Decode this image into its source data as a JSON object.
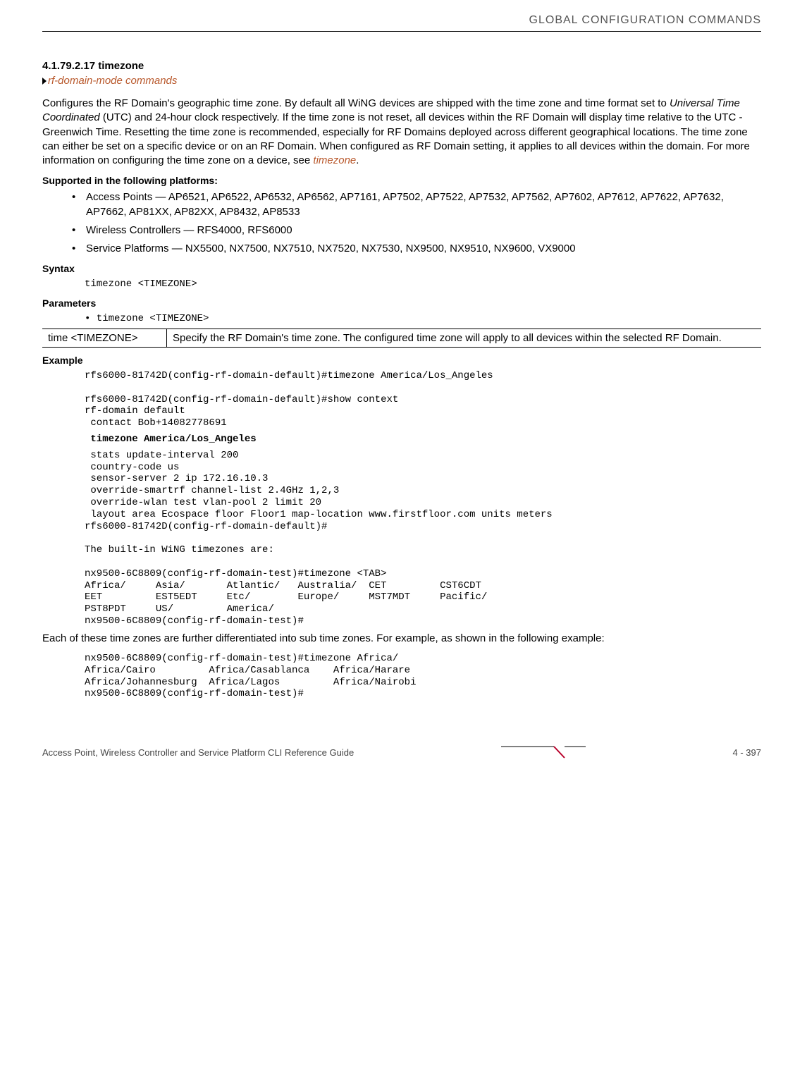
{
  "header": {
    "title": "GLOBAL CONFIGURATION COMMANDS"
  },
  "section": {
    "number": "4.1.79.2.17  timezone",
    "arrow_link": "rf-domain-mode commands",
    "para1_part1": "Configures the RF Domain's geographic time zone. By default all WiNG devices are shipped with the time zone and time format set to ",
    "para1_italic": "Universal Time Coordinated",
    "para1_part2": " (UTC) and 24-hour clock respectively. If the time zone is not reset, all devices within the RF Domain will display time relative to the UTC - Greenwich Time. Resetting the time zone is recommended, especially for RF Domains deployed across different geographical locations. The time zone can either be set on a specific device or on an RF Domain. When configured as RF Domain setting, it applies to all devices within the domain. For more information on configuring the time zone on a device, see ",
    "para1_link": "timezone",
    "para1_part3": "."
  },
  "platforms": {
    "heading": "Supported in the following platforms:",
    "items": [
      "Access Points — AP6521, AP6522, AP6532, AP6562, AP7161, AP7502, AP7522, AP7532, AP7562, AP7602, AP7612, AP7622, AP7632, AP7662, AP81XX, AP82XX, AP8432, AP8533",
      "Wireless Controllers — RFS4000, RFS6000",
      "Service Platforms — NX5500, NX7500, NX7510, NX7520, NX7530, NX9500, NX9510, NX9600, VX9000"
    ]
  },
  "syntax": {
    "heading": "Syntax",
    "code": "timezone <TIMEZONE>"
  },
  "parameters": {
    "heading": "Parameters",
    "param_line": "• timezone <TIMEZONE>",
    "table": {
      "cell1": "time <TIMEZONE>",
      "cell2": "Specify the RF Domain's time zone. The configured time zone will apply to all devices within the selected RF Domain."
    }
  },
  "example": {
    "heading": "Example",
    "code1": "rfs6000-81742D(config-rf-domain-default)#timezone America/Los_Angeles\n\nrfs6000-81742D(config-rf-domain-default)#show context\nrf-domain default\n contact Bob+14082778691",
    "code_bold": " timezone America/Los_Angeles",
    "code2": " stats update-interval 200\n country-code us\n sensor-server 2 ip 172.16.10.3\n override-smartrf channel-list 2.4GHz 1,2,3\n override-wlan test vlan-pool 2 limit 20\n layout area Ecospace floor Floor1 map-location www.firstfloor.com units meters\nrfs6000-81742D(config-rf-domain-default)#\n\nThe built-in WiNG timezones are:\n\nnx9500-6C8809(config-rf-domain-test)#timezone <TAB>\nAfrica/     Asia/       Atlantic/   Australia/  CET         CST6CDT\nEET         EST5EDT     Etc/        Europe/     MST7MDT     Pacific/\nPST8PDT     US/         America/\nnx9500-6C8809(config-rf-domain-test)#",
    "sub_para": "Each of these time zones are further differentiated into sub time zones. For example, as shown in the following example:",
    "code3": "nx9500-6C8809(config-rf-domain-test)#timezone Africa/\nAfrica/Cairo         Africa/Casablanca    Africa/Harare\nAfrica/Johannesburg  Africa/Lagos         Africa/Nairobi\nnx9500-6C8809(config-rf-domain-test)#"
  },
  "footer": {
    "text": "Access Point, Wireless Controller and Service Platform CLI Reference Guide",
    "page": "4 - 397"
  }
}
